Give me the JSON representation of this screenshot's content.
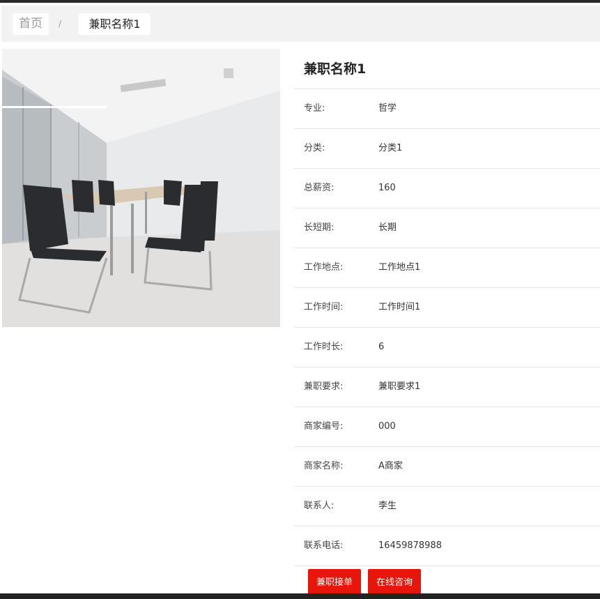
{
  "breadcrumb": {
    "home": "首页",
    "separator": "/",
    "current": "兼职名称1"
  },
  "detail": {
    "title": "兼职名称1",
    "rows": [
      {
        "label": "专业:",
        "value": "哲学"
      },
      {
        "label": "分类:",
        "value": "分类1"
      },
      {
        "label": "总薪资:",
        "value": "160"
      },
      {
        "label": "长短期:",
        "value": "长期"
      },
      {
        "label": "工作地点:",
        "value": "工作地点1"
      },
      {
        "label": "工作时间:",
        "value": "工作时间1"
      },
      {
        "label": "工作时长:",
        "value": "6"
      },
      {
        "label": "兼职要求:",
        "value": "兼职要求1"
      },
      {
        "label": "商家编号:",
        "value": "000"
      },
      {
        "label": "商家名称:",
        "value": "A商家"
      },
      {
        "label": "联系人:",
        "value": "李生"
      },
      {
        "label": "联系电话:",
        "value": "16459878988"
      }
    ]
  },
  "actions": {
    "accept": "兼职接单",
    "consult": "在线咨询"
  },
  "colors": {
    "button": "#e8150b",
    "breadcrumb_bg": "#f2f2f2"
  }
}
